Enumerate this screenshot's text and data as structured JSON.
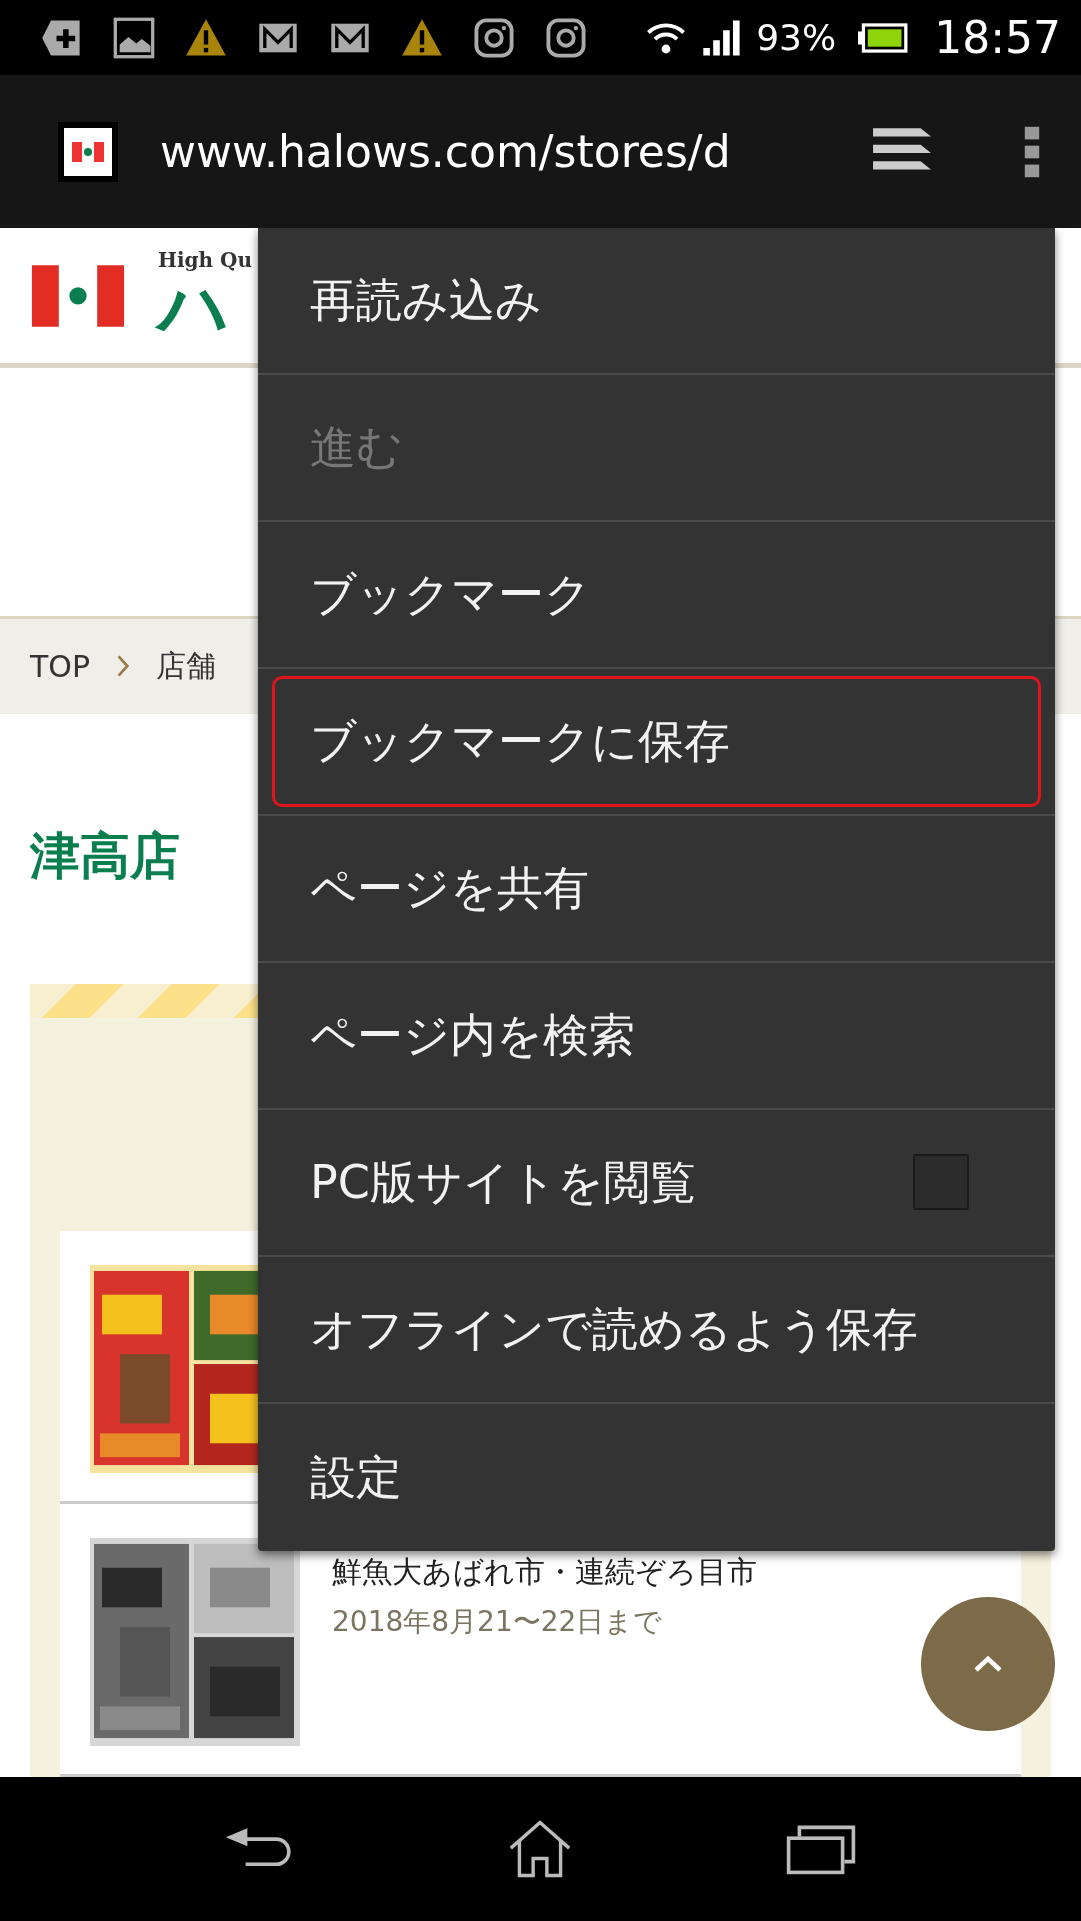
{
  "status_bar": {
    "battery": "93%",
    "time": "18:57"
  },
  "address_bar": {
    "url": "www.halows.com/stores/d"
  },
  "page": {
    "logo_tagline": "High Qu",
    "logo_text": "ハ",
    "breadcrumb": [
      "TOP",
      "店舗"
    ],
    "store_title": "津高店",
    "flyers": [
      {
        "kind": "picture"
      },
      {
        "kind": "picture",
        "title": "鮮魚大あばれ市・連続ぞろ目市",
        "date": "2018年8月21〜22日まで"
      }
    ]
  },
  "menu": {
    "items": [
      {
        "kind": "item",
        "label": "再読み込み",
        "disabled": false,
        "selected": false
      },
      {
        "kind": "item",
        "label": "進む",
        "disabled": true,
        "selected": false
      },
      {
        "kind": "item",
        "label": "ブックマーク",
        "disabled": false,
        "selected": false
      },
      {
        "kind": "item",
        "label": "ブックマークに保存",
        "disabled": false,
        "selected": true
      },
      {
        "kind": "item",
        "label": "ページを共有",
        "disabled": false,
        "selected": false
      },
      {
        "kind": "item",
        "label": "ページ内を検索",
        "disabled": false,
        "selected": false
      },
      {
        "kind": "checkbox",
        "label": "PC版サイトを閲覧",
        "disabled": false,
        "selected": false,
        "checked": false
      },
      {
        "kind": "item",
        "label": "オフラインで読めるよう保存",
        "disabled": false,
        "selected": false
      },
      {
        "kind": "item",
        "label": "設定",
        "disabled": false,
        "selected": false
      }
    ]
  }
}
